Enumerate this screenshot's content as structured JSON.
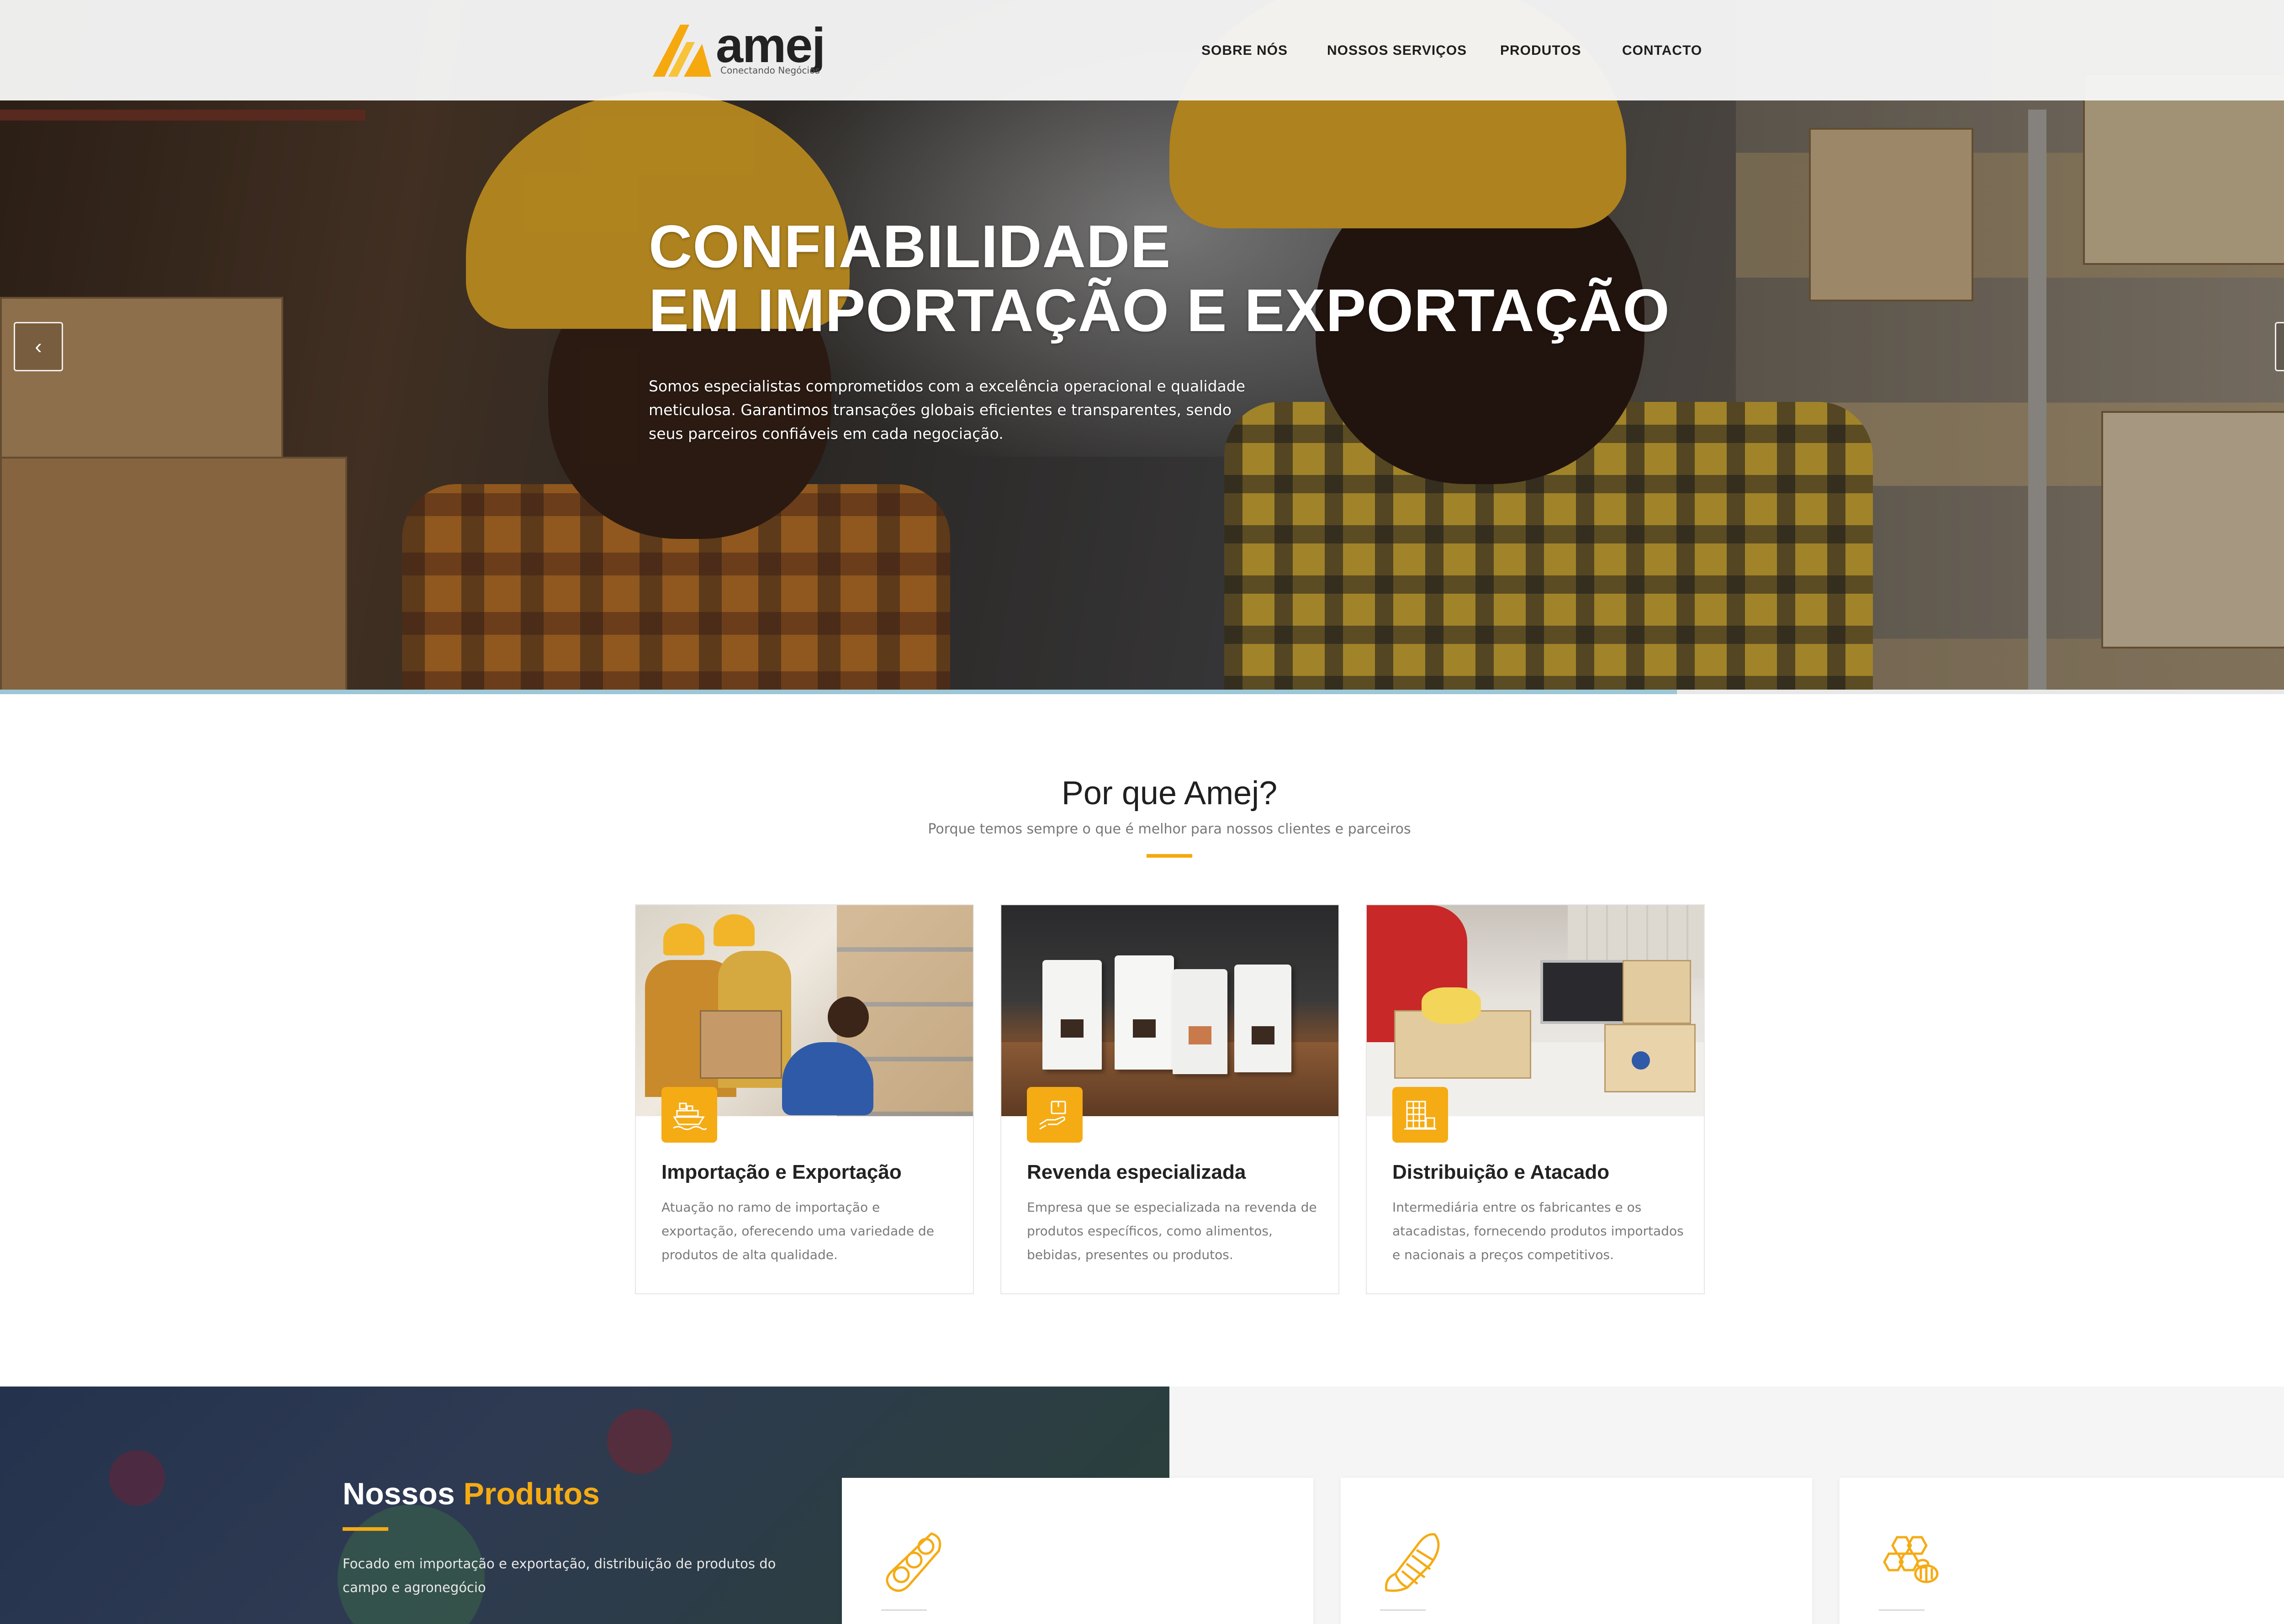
{
  "header": {
    "logo_text": "amej",
    "logo_tagline": "Conectando Negócios",
    "nav": [
      "SOBRE NÓS",
      "NOSSOS SERVIÇOS",
      "PRODUTOS",
      "CONTACTO"
    ]
  },
  "hero": {
    "title_line1": "CONFIABILIDADE",
    "title_line2": "EM IMPORTAÇÃO E EXPORTAÇÃO",
    "text": "Somos especialistas comprometidos com a excelência operacional e qualidade meticulosa. Garantimos transações globais eficientes e transparentes, sendo seus parceiros confiáveis em cada negociação.",
    "prev_icon": "chevron-left-icon",
    "next_icon": "chevron-right-icon",
    "slide_progress": 0.717
  },
  "why": {
    "title": "Por que Amej?",
    "subtitle": "Porque temos sempre o que é melhor para nossos clientes e parceiros",
    "cards": [
      {
        "icon": "cargo-ship-icon",
        "title": "Importação e Exportação",
        "text": "Atuação no ramo de importação e exportação, oferecendo uma variedade de produtos de alta qualidade."
      },
      {
        "icon": "delivery-hand-icon",
        "title": "Revenda especializada",
        "text": "Empresa que se especializada na revenda de produtos específicos, como alimentos, bebidas, presentes ou produtos."
      },
      {
        "icon": "warehouse-icon",
        "title": "Distribuição e Atacado",
        "text": "Intermediária entre os fabricantes e os atacadistas, fornecendo produtos importados e nacionais a preços competitivos."
      }
    ]
  },
  "products": {
    "title_prefix": "Nossos",
    "title_highlight": "Produtos",
    "text": "Focado em importação e exportação, distribuição de produtos do campo e agronegócio",
    "cards": [
      {
        "icon": "soybean-icon"
      },
      {
        "icon": "corn-icon"
      },
      {
        "icon": "honeycomb-bee-icon"
      }
    ]
  },
  "colors": {
    "accent": "#f5ab14",
    "progress": "#9cc7d6",
    "dark_section": "#24324d"
  }
}
